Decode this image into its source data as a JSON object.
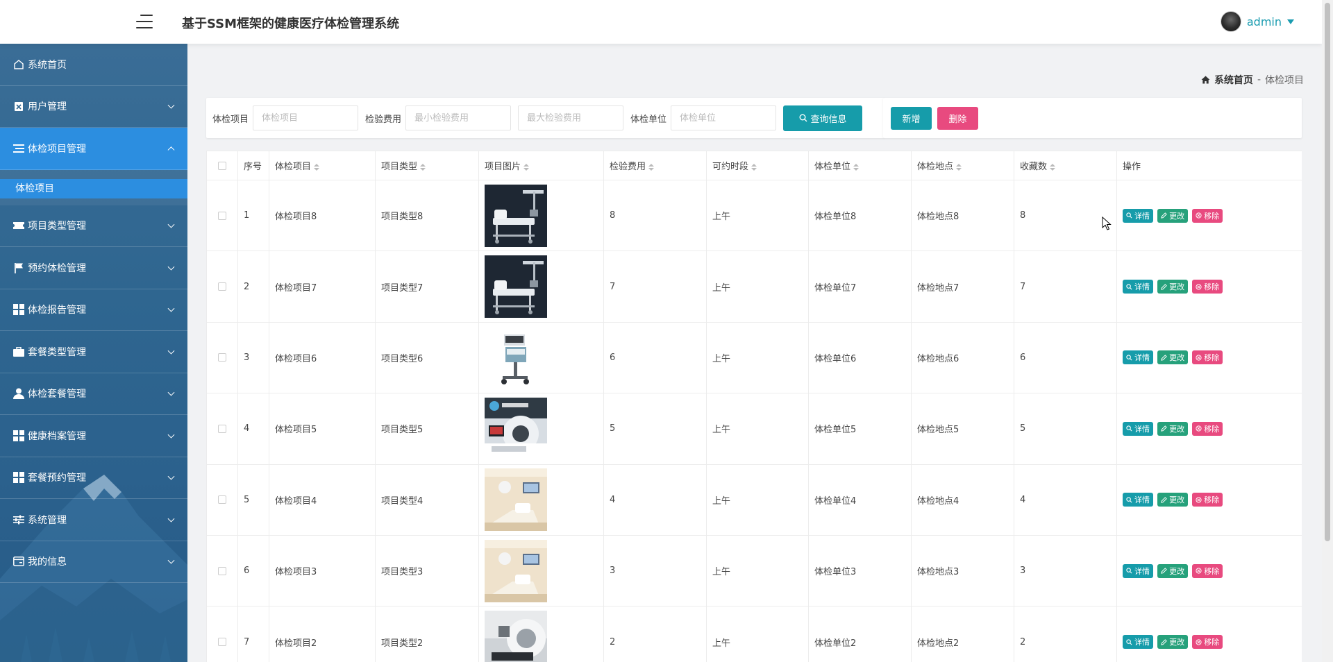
{
  "header": {
    "title": "基于SSM框架的健康医疗体检管理系统",
    "username": "admin"
  },
  "sidebar": {
    "items": [
      {
        "label": "系统首页",
        "icon": "home-icon"
      },
      {
        "label": "用户管理",
        "icon": "clipboard-icon"
      },
      {
        "label": "体检项目管理",
        "icon": "list-icon",
        "expanded": true,
        "sub": [
          {
            "label": "体检项目"
          }
        ]
      },
      {
        "label": "项目类型管理",
        "icon": "ticket-icon"
      },
      {
        "label": "预约体检管理",
        "icon": "flag-icon"
      },
      {
        "label": "体检报告管理",
        "icon": "grid-icon"
      },
      {
        "label": "套餐类型管理",
        "icon": "briefcase-icon"
      },
      {
        "label": "体检套餐管理",
        "icon": "user-icon"
      },
      {
        "label": "健康档案管理",
        "icon": "grid-icon"
      },
      {
        "label": "套餐预约管理",
        "icon": "grid-icon"
      },
      {
        "label": "系统管理",
        "icon": "sliders-icon"
      },
      {
        "label": "我的信息",
        "icon": "card-icon"
      }
    ]
  },
  "breadcrumb": {
    "home": "系统首页",
    "separator": "-",
    "current": "体检项目"
  },
  "search": {
    "label_item": "体检项目",
    "placeholder_item": "体检项目",
    "label_fee": "检验费用",
    "placeholder_min_fee": "最小检验费用",
    "placeholder_max_fee": "最大检验费用",
    "label_unit": "体检单位",
    "placeholder_unit": "体检单位",
    "button": "查询信息"
  },
  "actions": {
    "add": "新增",
    "delete": "删除"
  },
  "table": {
    "headers": [
      "序号",
      "体检项目",
      "项目类型",
      "项目图片",
      "检验费用",
      "可约时段",
      "体检单位",
      "体检地点",
      "收藏数",
      "操作"
    ],
    "op_detail": "详情",
    "op_edit": "更改",
    "op_remove": "移除",
    "rows": [
      {
        "no": "1",
        "item": "体检项目8",
        "type": "项目类型8",
        "image": "dark-bed",
        "fee": "8",
        "period": "上午",
        "unit": "体检单位8",
        "place": "体检地点8",
        "fav": "8"
      },
      {
        "no": "2",
        "item": "体检项目7",
        "type": "项目类型7",
        "image": "dark-bed",
        "fee": "7",
        "period": "上午",
        "unit": "体检单位7",
        "place": "体检地点7",
        "fav": "7"
      },
      {
        "no": "3",
        "item": "体检项目6",
        "type": "项目类型6",
        "image": "cart",
        "fee": "6",
        "period": "上午",
        "unit": "体检单位6",
        "place": "体检地点6",
        "fav": "6"
      },
      {
        "no": "4",
        "item": "体检项目5",
        "type": "项目类型5",
        "image": "scanner",
        "fee": "5",
        "period": "上午",
        "unit": "体检单位5",
        "place": "体检地点5",
        "fav": "5"
      },
      {
        "no": "5",
        "item": "体检项目4",
        "type": "项目类型4",
        "image": "room",
        "fee": "4",
        "period": "上午",
        "unit": "体检单位4",
        "place": "体检地点4",
        "fav": "4"
      },
      {
        "no": "6",
        "item": "体检项目3",
        "type": "项目类型3",
        "image": "room",
        "fee": "3",
        "period": "上午",
        "unit": "体检单位3",
        "place": "体检地点3",
        "fav": "3"
      },
      {
        "no": "7",
        "item": "体检项目2",
        "type": "项目类型2",
        "image": "mri",
        "fee": "2",
        "period": "上午",
        "unit": "体检单位2",
        "place": "体检地点2",
        "fav": "2"
      }
    ]
  },
  "colors": {
    "sidebar_bg": "#2f6690",
    "sidebar_active": "#2c8ee0",
    "primary": "#169caa",
    "danger": "#e84a7f",
    "edit": "#26a17b"
  }
}
